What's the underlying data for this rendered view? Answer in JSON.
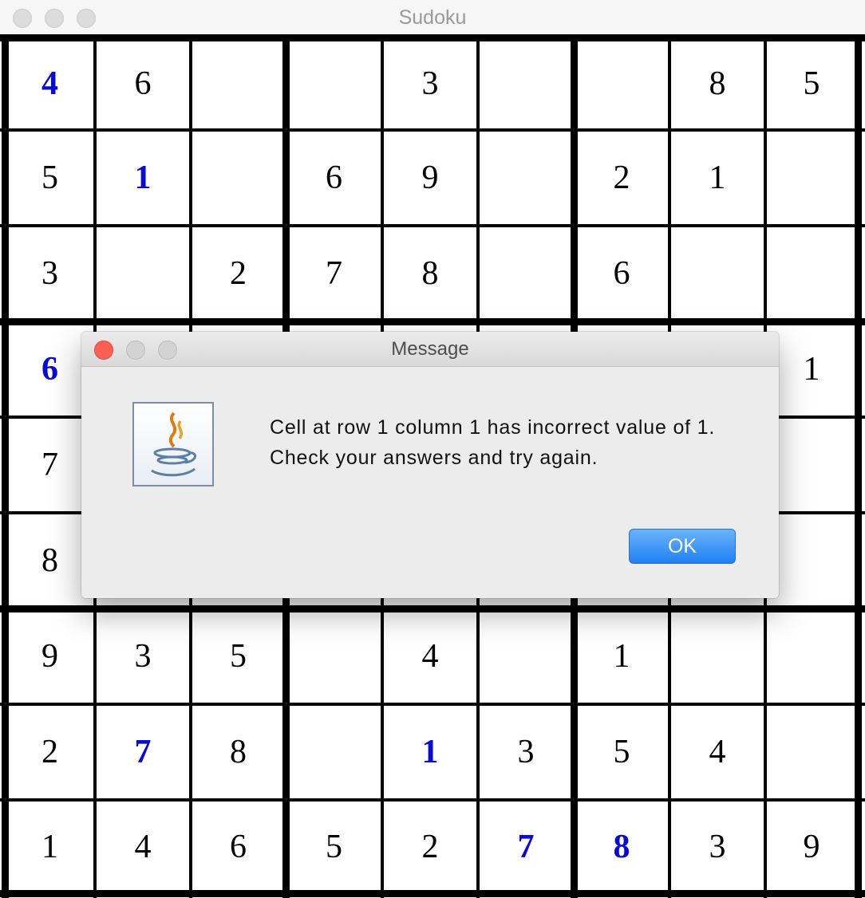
{
  "window": {
    "title": "Sudoku"
  },
  "board": [
    [
      {
        "v": "4",
        "g": true
      },
      {
        "v": "6"
      },
      {
        "v": ""
      },
      {
        "v": ""
      },
      {
        "v": "3"
      },
      {
        "v": ""
      },
      {
        "v": ""
      },
      {
        "v": "8"
      },
      {
        "v": "5"
      }
    ],
    [
      {
        "v": "5"
      },
      {
        "v": "1",
        "g": true
      },
      {
        "v": ""
      },
      {
        "v": "6"
      },
      {
        "v": "9"
      },
      {
        "v": ""
      },
      {
        "v": "2"
      },
      {
        "v": "1"
      },
      {
        "v": ""
      }
    ],
    [
      {
        "v": "3"
      },
      {
        "v": ""
      },
      {
        "v": "2"
      },
      {
        "v": "7"
      },
      {
        "v": "8"
      },
      {
        "v": ""
      },
      {
        "v": "6"
      },
      {
        "v": ""
      },
      {
        "v": ""
      }
    ],
    [
      {
        "v": "6",
        "g": true
      },
      {
        "v": ""
      },
      {
        "v": ""
      },
      {
        "v": ""
      },
      {
        "v": ""
      },
      {
        "v": ""
      },
      {
        "v": ""
      },
      {
        "v": ""
      },
      {
        "v": "1"
      }
    ],
    [
      {
        "v": "7"
      },
      {
        "v": ""
      },
      {
        "v": ""
      },
      {
        "v": ""
      },
      {
        "v": ""
      },
      {
        "v": ""
      },
      {
        "v": ""
      },
      {
        "v": ""
      },
      {
        "v": ""
      }
    ],
    [
      {
        "v": "8"
      },
      {
        "v": ""
      },
      {
        "v": ""
      },
      {
        "v": ""
      },
      {
        "v": ""
      },
      {
        "v": ""
      },
      {
        "v": ""
      },
      {
        "v": ""
      },
      {
        "v": ""
      }
    ],
    [
      {
        "v": "9"
      },
      {
        "v": "3"
      },
      {
        "v": "5"
      },
      {
        "v": ""
      },
      {
        "v": "4"
      },
      {
        "v": ""
      },
      {
        "v": "1"
      },
      {
        "v": ""
      },
      {
        "v": ""
      }
    ],
    [
      {
        "v": "2"
      },
      {
        "v": "7",
        "g": true
      },
      {
        "v": "8"
      },
      {
        "v": ""
      },
      {
        "v": "1",
        "g": true
      },
      {
        "v": "3"
      },
      {
        "v": "5"
      },
      {
        "v": "4"
      },
      {
        "v": ""
      }
    ],
    [
      {
        "v": "1"
      },
      {
        "v": "4"
      },
      {
        "v": "6"
      },
      {
        "v": "5"
      },
      {
        "v": "2"
      },
      {
        "v": "7",
        "g": true
      },
      {
        "v": "8",
        "g": true
      },
      {
        "v": "3"
      },
      {
        "v": "9"
      }
    ]
  ],
  "colors": {
    "given_digit": "#0a0ad6",
    "plain_digit": "#000000",
    "ok_button": "#1f80f3",
    "close_button": "#fc5f56"
  },
  "dialog": {
    "title": "Message",
    "icon": "java-coffee-cup-icon",
    "message_line_1": "Cell at row 1 column 1 has incorrect value of 1.",
    "message_line_2": "Check your answers and try again.",
    "ok_label": "OK"
  }
}
